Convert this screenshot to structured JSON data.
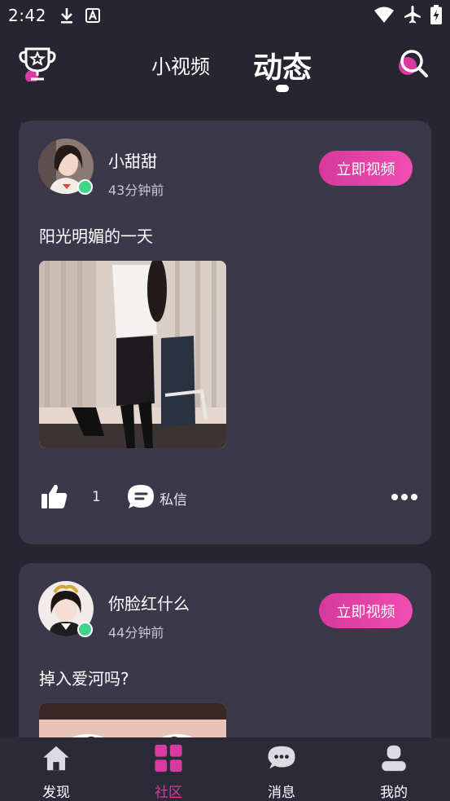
{
  "status_bar": {
    "time": "2:42",
    "left_icons": [
      "download-icon",
      "font-badge-icon"
    ],
    "right_icons": [
      "wifi-icon",
      "airplane-icon",
      "battery-charging-icon"
    ]
  },
  "header": {
    "tabs": [
      {
        "label": "小视频",
        "active": false
      },
      {
        "label": "动态",
        "active": true
      }
    ],
    "left_icon": "trophy-icon",
    "right_icon": "search-icon"
  },
  "posts": [
    {
      "user_name": "小甜甜",
      "time_ago": "43分钟前",
      "video_button": "立即视频",
      "text": "阳光明媚的一天",
      "likes": "1",
      "message_label": "私信",
      "online": true
    },
    {
      "user_name": "你脸红什么",
      "time_ago": "44分钟前",
      "video_button": "立即视频",
      "text": "掉入爱河吗?",
      "online": true
    }
  ],
  "bottom_nav": [
    {
      "label": "发现",
      "icon": "home-icon",
      "active": false
    },
    {
      "label": "社区",
      "icon": "grid-icon",
      "active": true
    },
    {
      "label": "消息",
      "icon": "chat-icon",
      "active": false
    },
    {
      "label": "我的",
      "icon": "profile-icon",
      "active": false
    }
  ],
  "colors": {
    "accent": "#d83a9f",
    "background": "#27252f",
    "card": "#3a3849",
    "online": "#3fd58b"
  }
}
